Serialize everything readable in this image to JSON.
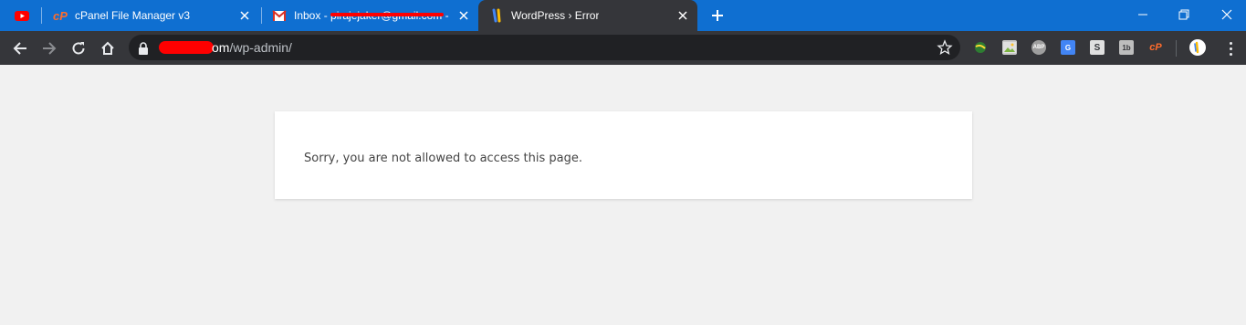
{
  "tabs": [
    {
      "title": "",
      "favicon": "youtube-icon"
    },
    {
      "title": "cPanel File Manager v3",
      "favicon": "cpanel-icon"
    },
    {
      "title": "Inbox - pirajejaker@gmail.com -",
      "favicon": "gmail-icon"
    },
    {
      "title": "WordPress › Error",
      "favicon": "wordpress-icon",
      "active": true
    }
  ],
  "toolbar": {
    "url_visible": "om",
    "url_path": "/wp-admin/"
  },
  "extensions": [
    "globe-icon",
    "image-icon",
    "abp-icon",
    "translate-icon",
    "s-icon",
    "1b-icon",
    "cpanel-ext-icon",
    "profile-avatar"
  ],
  "page": {
    "message": "Sorry, you are not allowed to access this page."
  },
  "colors": {
    "tabstrip": "#0f6fd1",
    "toolbar": "#35363a",
    "omnibox": "#202124",
    "page_bg": "#f1f1f1",
    "card_bg": "#ffffff",
    "text": "#444444"
  }
}
